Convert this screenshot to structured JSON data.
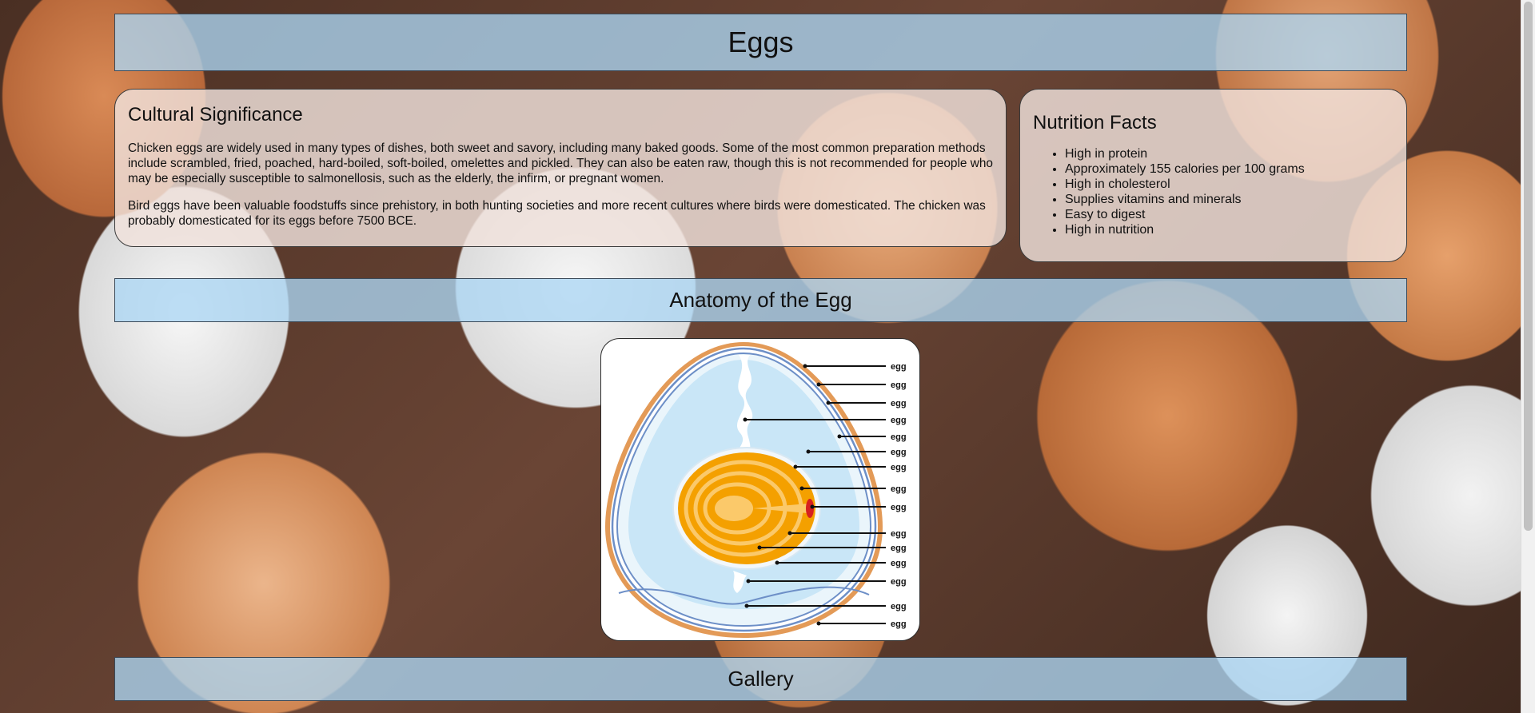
{
  "header": {
    "title": "Eggs"
  },
  "cultural": {
    "heading": "Cultural Significance",
    "paragraphs": [
      "Chicken eggs are widely used in many types of dishes, both sweet and savory, including many baked goods. Some of the most common preparation methods include scrambled, fried, poached, hard-boiled, soft-boiled, omelettes and pickled. They can also be eaten raw, though this is not recommended for people who may be especially susceptible to salmonellosis, such as the elderly, the infirm, or pregnant women.",
      "Bird eggs have been valuable foodstuffs since prehistory, in both hunting societies and more recent cultures where birds were domesticated. The chicken was probably domesticated for its eggs before 7500 BCE."
    ]
  },
  "nutrition": {
    "heading": "Nutrition Facts",
    "items": [
      "High in protein",
      "Approximately 155 calories per 100 grams",
      "High in cholesterol",
      "Supplies vitamins and minerals",
      "Easy to digest",
      "High in nutrition"
    ]
  },
  "anatomy": {
    "heading": "Anatomy of the Egg",
    "labels": [
      "egg",
      "egg",
      "egg",
      "egg",
      "egg",
      "egg",
      "egg",
      "egg",
      "egg",
      "egg",
      "egg",
      "egg",
      "egg",
      "egg",
      "egg"
    ]
  },
  "gallery": {
    "heading": "Gallery"
  },
  "colors": {
    "section_bar": "#acd6f3",
    "panel": "#f0e2dc",
    "yolk_outer": "#f4a000",
    "yolk_inner": "#fbc96a",
    "albumen": "#c9e6f7",
    "shell": "#e39a57",
    "membrane": "#6d8fc7",
    "germinal_disc": "#d62020"
  }
}
